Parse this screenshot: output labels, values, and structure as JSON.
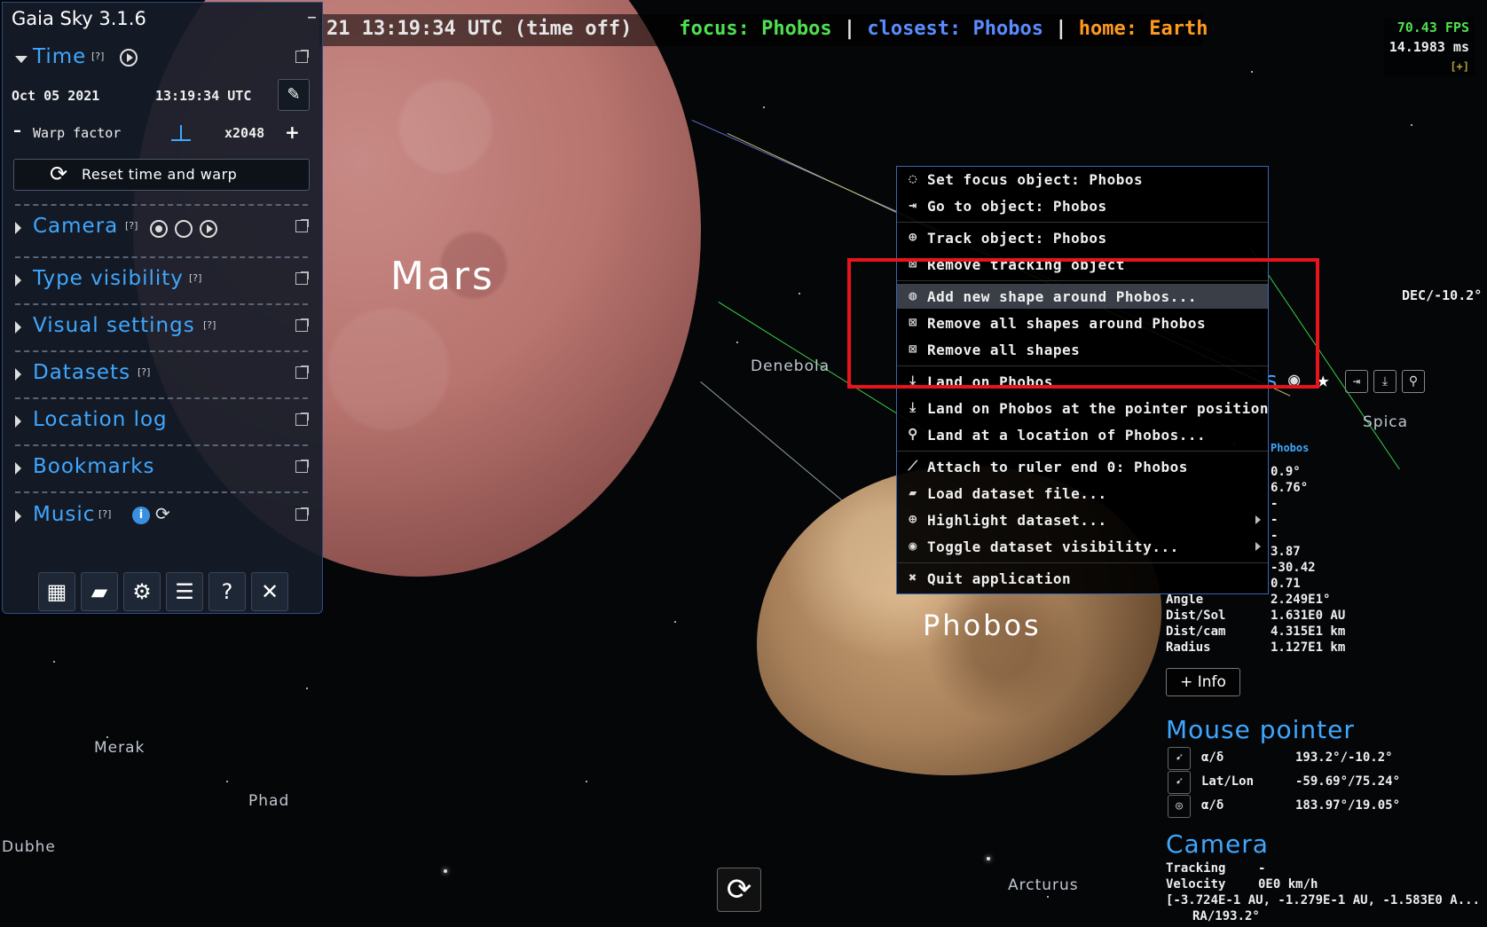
{
  "topbar": {
    "time_text": "21 13:19:34 UTC (time off)",
    "focus_label": "focus:",
    "focus_value": "Phobos",
    "closest_label": "closest:",
    "closest_value": "Phobos",
    "home_label": "home:",
    "home_value": "Earth",
    "separator": "|",
    "fps": "70.43 FPS",
    "frame_time": "14.1983 ms",
    "fps_toggle": "[+]"
  },
  "panel": {
    "title": "Gaia Sky 3.1.6",
    "minimize": "–",
    "time": {
      "label": "Time",
      "help": "[?]",
      "date": "Oct 05 2021",
      "clock": "13:19:34 UTC",
      "warp_label": "Warp factor",
      "warp_value": "x2048",
      "warp_minus": "–",
      "warp_plus": "+",
      "reset_label": "Reset time and warp"
    },
    "sections": [
      {
        "label": "Camera",
        "help": "[?]"
      },
      {
        "label": "Type visibility",
        "help": "[?]"
      },
      {
        "label": "Visual settings",
        "help": "[?]"
      },
      {
        "label": "Datasets",
        "help": "[?]"
      },
      {
        "label": "Location log",
        "help": ""
      },
      {
        "label": "Bookmarks",
        "help": ""
      },
      {
        "label": "Music",
        "help": "[?]"
      }
    ],
    "toolbar_icons": [
      "map-icon",
      "folder-open-icon",
      "gear-icon",
      "log-icon",
      "help-icon",
      "close-icon"
    ]
  },
  "scene": {
    "mars_label": "Mars",
    "phobos_label": "Phobos",
    "stars": {
      "denebola": "Denebola",
      "spica": "Spica",
      "merak": "Merak",
      "phad": "Phad",
      "dubhe": "Dubhe",
      "arcturus": "Arcturus"
    },
    "dec_readout": "DEC/-10.2°"
  },
  "context_menu": {
    "items": [
      {
        "label": "Set focus object: Phobos",
        "icon": "focus-icon"
      },
      {
        "label": "Go to object: Phobos",
        "icon": "goto-icon"
      },
      {
        "label": "Track object: Phobos",
        "icon": "track-icon"
      },
      {
        "label": "Remove tracking object",
        "icon": "remove-icon"
      },
      {
        "label": "Add new shape around Phobos...",
        "icon": "shape-icon"
      },
      {
        "label": "Remove all shapes around Phobos",
        "icon": "remove-icon"
      },
      {
        "label": "Remove all shapes",
        "icon": "remove-icon"
      },
      {
        "label": "Land on Phobos",
        "icon": "land-icon"
      },
      {
        "label": "Land on Phobos at the pointer position",
        "icon": "land-icon"
      },
      {
        "label": "Land at a location of Phobos...",
        "icon": "location-pin-icon"
      },
      {
        "label": "Attach to ruler end 0: Phobos",
        "icon": "ruler-icon"
      },
      {
        "label": "Load dataset file...",
        "icon": "folder-open-icon"
      },
      {
        "label": "Highlight dataset...",
        "icon": "highlight-icon"
      },
      {
        "label": "Toggle dataset visibility...",
        "icon": "eye-icon"
      },
      {
        "label": "Quit application",
        "icon": "close-icon"
      }
    ],
    "highlighted_index": 4
  },
  "focus_info": {
    "name_fragment": "s",
    "obj_type": "Phobos",
    "rows": [
      {
        "value": "0.9°"
      },
      {
        "value": "6.76°"
      },
      {
        "value": "-"
      },
      {
        "value": "-"
      },
      {
        "value": "-"
      },
      {
        "value": "3.87"
      },
      {
        "value": "-30.42"
      },
      {
        "value": "0.71"
      }
    ],
    "props": [
      {
        "key": "Angle",
        "value": "2.249E1°"
      },
      {
        "key": "Dist/Sol",
        "value": "1.631E0 AU"
      },
      {
        "key": "Dist/cam",
        "value": "4.315E1 km"
      },
      {
        "key": "Radius",
        "value": "1.127E1 km"
      }
    ],
    "more_button": "+ Info"
  },
  "mouse_pointer": {
    "title": "Mouse pointer",
    "rows": [
      {
        "key": "α/δ",
        "value": "193.2°/-10.2°"
      },
      {
        "key": "Lat/Lon",
        "value": "-59.69°/75.24°"
      },
      {
        "key": "α/δ",
        "value": "183.97°/19.05°"
      }
    ]
  },
  "camera_info": {
    "title": "Camera",
    "tracking_label": "Tracking",
    "tracking_value": "-",
    "velocity_label": "Velocity",
    "velocity_value": "0E0 km/h",
    "position": "[-3.724E-1 AU, -1.279E-1 AU, -1.583E0 A...",
    "ra": "RA/193.2°"
  }
}
